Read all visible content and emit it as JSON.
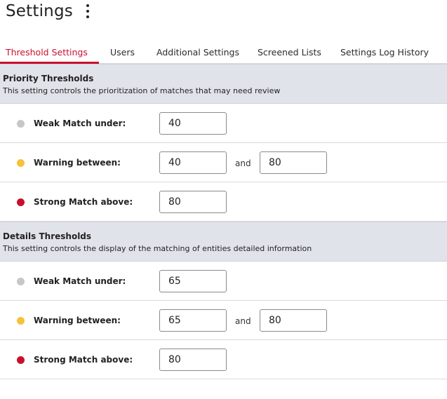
{
  "header": {
    "title": "Settings",
    "more_icon": "kebab-vertical-icon"
  },
  "tabs": [
    {
      "label": "Threshold Settings",
      "active": true
    },
    {
      "label": "Users",
      "active": false
    },
    {
      "label": "Additional Settings",
      "active": false
    },
    {
      "label": "Screened Lists",
      "active": false
    },
    {
      "label": "Settings Log History",
      "active": false
    }
  ],
  "colors": {
    "accent": "#c8102e",
    "weak": "#c6c6cb",
    "warning": "#f7c13b",
    "strong": "#c8102e"
  },
  "sections": [
    {
      "title": "Priority Thresholds",
      "description": "This setting controls the prioritization of matches that may need review",
      "rows": [
        {
          "label": "Weak Match under:",
          "level": "weak",
          "value": "40"
        },
        {
          "label": "Warning between:",
          "level": "warning",
          "value": "40",
          "connector": "and",
          "value2": "80"
        },
        {
          "label": "Strong Match above:",
          "level": "strong",
          "value": "80"
        }
      ]
    },
    {
      "title": "Details Thresholds",
      "description": "This setting controls the display of the matching of entities detailed information",
      "rows": [
        {
          "label": "Weak Match under:",
          "level": "weak",
          "value": "65"
        },
        {
          "label": "Warning between:",
          "level": "warning",
          "value": "65",
          "connector": "and",
          "value2": "80"
        },
        {
          "label": "Strong Match above:",
          "level": "strong",
          "value": "80"
        }
      ]
    }
  ]
}
